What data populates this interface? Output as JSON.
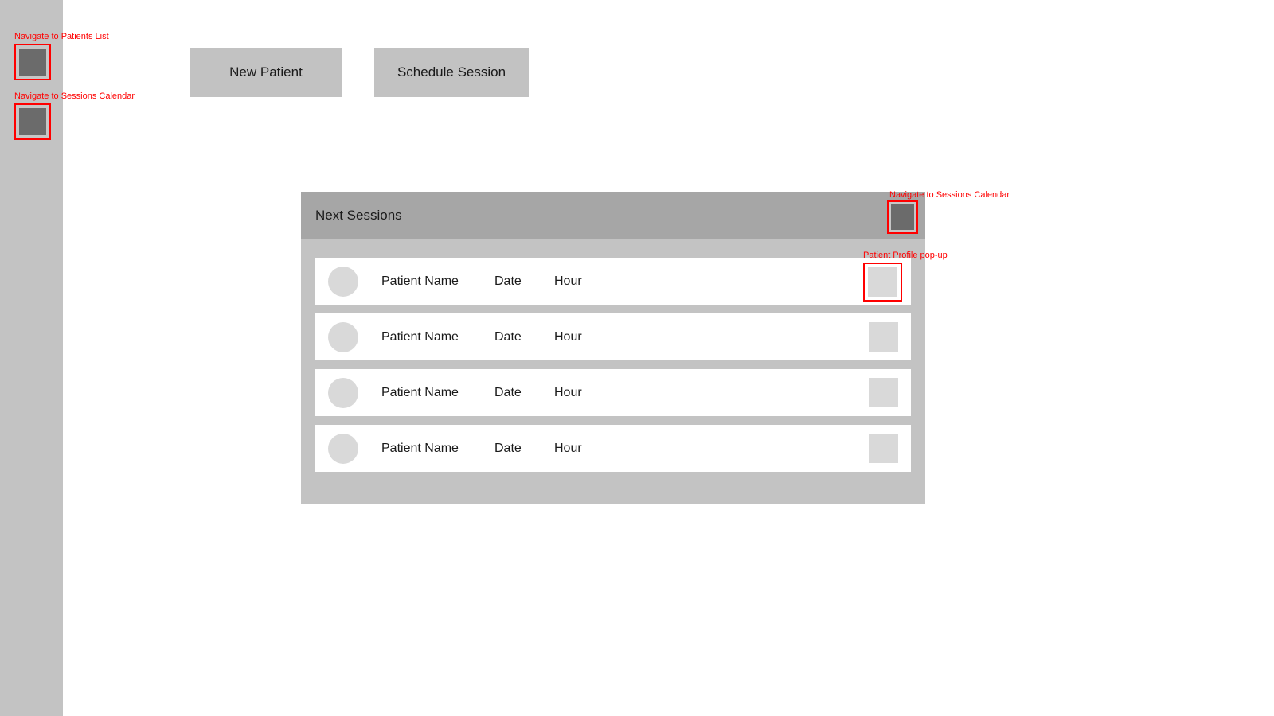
{
  "theme": {
    "sidebar_bg": "#c3c3c3",
    "panel_bg": "#c3c3c3",
    "panel_header_bg": "#a6a6a6",
    "button_bg": "#c2c2c2",
    "icon_dark": "#6b6b6b",
    "placeholder_light": "#d9d9d9",
    "annotation_color": "#ff0000",
    "page_bg": "#ffffff",
    "text_color": "#1a1a1a"
  },
  "sidebar": {
    "items": [
      {
        "annotation": "Navigate to Patients List",
        "icon": "square-placeholder-icon",
        "annotated": true
      },
      {
        "annotation": "Navigate to Sessions Calendar",
        "icon": "square-placeholder-icon",
        "annotated": true
      }
    ]
  },
  "toolbar": {
    "new_patient_label": "New Patient",
    "schedule_session_label": "Schedule Session"
  },
  "panel": {
    "title": "Next Sessions",
    "calendar_button": {
      "annotation": "Navigate to Sessions Calendar",
      "icon": "calendar-icon",
      "annotated": true
    },
    "columns": {
      "avatar": "avatar",
      "name": "Patient Name",
      "date": "Date",
      "hour": "Hour",
      "action": "profile-button"
    },
    "first_row_annotation": "Patient Profile pop-up",
    "rows": [
      {
        "avatar": "avatar-placeholder-icon",
        "name": "Patient Name",
        "date": "Date",
        "hour": "Hour",
        "action_icon": "profile-placeholder-icon",
        "annotated": true
      },
      {
        "avatar": "avatar-placeholder-icon",
        "name": "Patient Name",
        "date": "Date",
        "hour": "Hour",
        "action_icon": "profile-placeholder-icon",
        "annotated": false
      },
      {
        "avatar": "avatar-placeholder-icon",
        "name": "Patient Name",
        "date": "Date",
        "hour": "Hour",
        "action_icon": "profile-placeholder-icon",
        "annotated": false
      },
      {
        "avatar": "avatar-placeholder-icon",
        "name": "Patient Name",
        "date": "Date",
        "hour": "Hour",
        "action_icon": "profile-placeholder-icon",
        "annotated": false
      }
    ]
  }
}
